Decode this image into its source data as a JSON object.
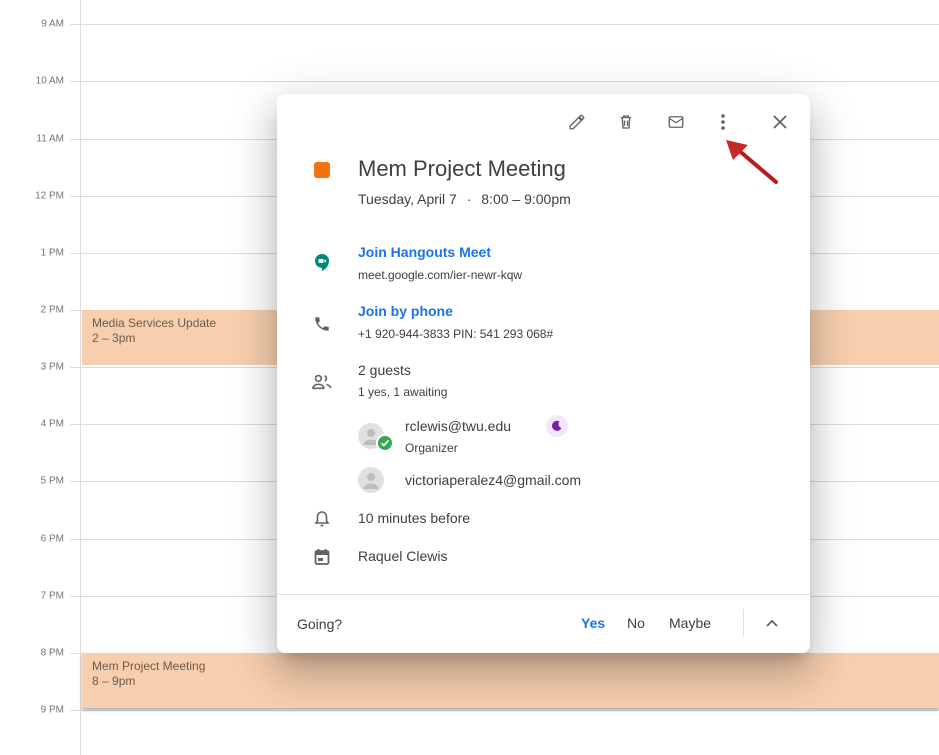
{
  "time_labels": [
    "9 AM",
    "10 AM",
    "11 AM",
    "12 PM",
    "1 PM",
    "2 PM",
    "3 PM",
    "4 PM",
    "5 PM",
    "6 PM",
    "7 PM",
    "8 PM",
    "9 PM"
  ],
  "events": [
    {
      "title": "Media Services Update",
      "time": "2 – 3pm"
    },
    {
      "title": "Mem Project Meeting",
      "time": "8 – 9pm"
    }
  ],
  "popup": {
    "toolbar": {
      "edit_icon": "pencil-icon",
      "delete_icon": "trash-icon",
      "email_icon": "envelope-icon",
      "more_icon": "more-vert-icon",
      "close_icon": "close-icon"
    },
    "color": "#f4720d",
    "title": "Mem Project Meeting",
    "date": "Tuesday, April 7",
    "separator": "·",
    "time": "8:00 – 9:00pm",
    "hangouts": {
      "label": "Join Hangouts Meet",
      "url": "meet.google.com/ier-newr-kqw"
    },
    "phone": {
      "label": "Join by phone",
      "details": "+1 920-944-3833 PIN: 541 293 068#"
    },
    "guests": {
      "count": "2 guests",
      "summary": "1 yes, 1 awaiting",
      "list": [
        {
          "email": "rclewis@twu.edu",
          "role": "Organizer"
        },
        {
          "email": "victoriaperalez4@gmail.com",
          "role": ""
        }
      ]
    },
    "reminder": "10 minutes before",
    "calendar": "Raquel Clewis",
    "footer": {
      "question": "Going?",
      "yes": "Yes",
      "no": "No",
      "maybe": "Maybe"
    }
  },
  "colors": {
    "event_bg": "#f8cfae",
    "link": "#1a73e8",
    "meet_green": "#00897b",
    "check_green": "#34a853",
    "moon_purple": "#7b1fa2"
  }
}
